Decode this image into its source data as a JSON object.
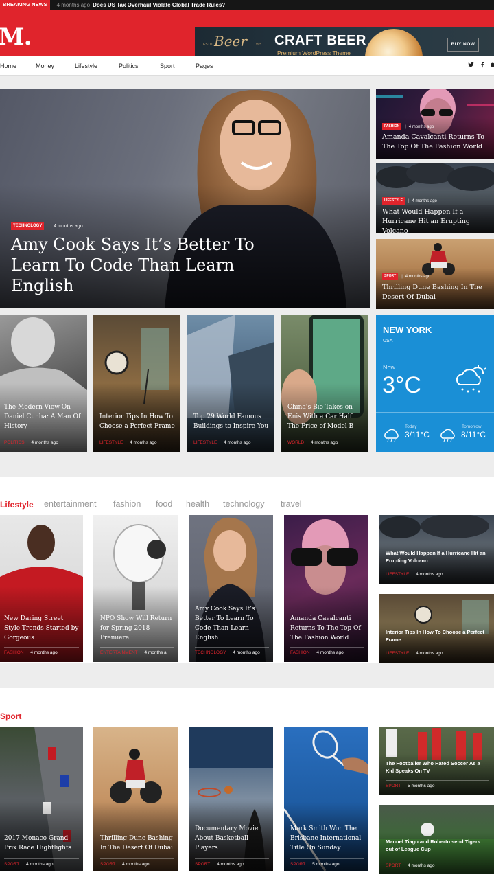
{
  "breaking": {
    "label": "BREAKING NEWS",
    "time": "4 months ago",
    "title": "Does US Tax Overhaul Violate Global Trade Rules?"
  },
  "site": {
    "logo": "M."
  },
  "ad": {
    "beer": "Beer",
    "est": "ESTD",
    "year": "1995",
    "title": "CRAFT BEER",
    "subtitle": "Premium WordPress Theme",
    "button": "BUY NOW"
  },
  "nav": {
    "items": [
      "Home",
      "Money",
      "Lifestyle",
      "Politics",
      "Sport",
      "Pages"
    ],
    "social": [
      "twitter-icon",
      "facebook-icon"
    ]
  },
  "hero": {
    "category": "TECHNOLOGY",
    "time": "4 months ago",
    "title": "Amy Cook Says It’s Better To Learn To Code Than Learn English"
  },
  "side": [
    {
      "category": "FASHION",
      "time": "4 months ago",
      "title": "Amanda Cavalcanti Returns To The Top Of The Fashion World"
    },
    {
      "category": "LIFESTYLE",
      "time": "4 months ago",
      "title": "What Would Happen If a Hurricane Hit an Erupting Volcano"
    },
    {
      "category": "SPORT",
      "time": "4 months ago",
      "title": "Thrilling Dune Bashing In The Desert Of Dubai"
    }
  ],
  "grid": [
    {
      "title": "The Modern View On Daniel Cunha: A Man Of History",
      "category": "POLITICS",
      "time": "4 months ago"
    },
    {
      "title": "Interior Tips In How To Choose a Perfect Frame",
      "category": "LIFESTYLE",
      "time": "4 months ago"
    },
    {
      "title": "Top 29 World Famous Buildings to Inspire You",
      "category": "LIFESTYLE",
      "time": "4 months ago"
    },
    {
      "title": "China’s Bio Takes on Enis With a Car Half The Price of Model B",
      "category": "WORLD",
      "time": "4 months ago"
    }
  ],
  "weather": {
    "city": "NEW YORK",
    "country": "USA",
    "now_label": "Now",
    "now_temp": "3°C",
    "today_label": "Today",
    "today_temp": "3/11°C",
    "tomorrow_label": "Tomorrow",
    "tomorrow_temp": "8/11°C"
  },
  "lifestyle": {
    "title": "Lifestyle",
    "tabs": [
      "entertainment",
      "fashion",
      "food",
      "health",
      "technology",
      "travel"
    ],
    "cards": [
      {
        "title": "New Daring Street Style Trends Started by Gorgeous",
        "category": "FASHION",
        "time": "4 months ago"
      },
      {
        "title": "NPO Show Will Return for Spring 2018 Premiere",
        "category": "ENTERTAINMENT",
        "time": "4 months a"
      },
      {
        "title": "Amy Cook Says It’s Better To Learn To Code Than Learn English",
        "category": "TECHNOLOGY",
        "time": "4 months ago"
      },
      {
        "title": "Amanda Cavalcanti Returns To The Top Of The Fashion World",
        "category": "FASHION",
        "time": "4 months ago"
      }
    ],
    "wide": [
      {
        "title": "What Would Happen If a Hurricane Hit an Erupting Volcano",
        "category": "LIFESTYLE",
        "time": "4 months ago"
      },
      {
        "title": "Interior Tips In How To Choose a Perfect Frame",
        "category": "LIFESTYLE",
        "time": "4 months ago"
      }
    ]
  },
  "sport": {
    "title": "Sport",
    "cards": [
      {
        "title": "2017 Monaco Grand Prix Race Hightlights",
        "category": "SPORT",
        "time": "4 months ago"
      },
      {
        "title": "Thrilling Dune Bashing In The Desert Of Dubai",
        "category": "SPORT",
        "time": "4 months ago"
      },
      {
        "title": "Documentary Movie About Basketball Players",
        "category": "SPORT",
        "time": "4 months ago"
      },
      {
        "title": "Mark Smith Won The Brisbane International Title On Sunday",
        "category": "SPORT",
        "time": "5 months ago"
      }
    ],
    "wide": [
      {
        "title": "The Footballer Who Hated Soccer As a Kid Speaks On TV",
        "category": "SPORT",
        "time": "5 months ago"
      },
      {
        "title": "Manuel Tiago and Roberto send Tigers out of League Cup",
        "category": "SPORT",
        "time": "4 months ago"
      }
    ]
  }
}
